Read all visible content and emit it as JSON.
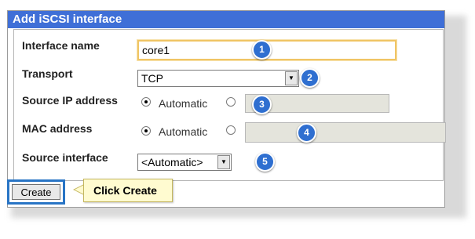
{
  "dialog": {
    "title": "Add iSCSI interface"
  },
  "form": {
    "interface_name": {
      "label": "Interface name",
      "value": "core1"
    },
    "transport": {
      "label": "Transport",
      "value": "TCP"
    },
    "source_ip": {
      "label": "Source IP address",
      "automatic_label": "Automatic",
      "value": ""
    },
    "mac_address": {
      "label": "MAC address",
      "automatic_label": "Automatic",
      "value": ""
    },
    "source_interface": {
      "label": "Source interface",
      "value": "<Automatic>"
    }
  },
  "badges": [
    "1",
    "2",
    "3",
    "4",
    "5"
  ],
  "actions": {
    "create_label": "Create"
  },
  "callout": {
    "text": "Click Create"
  },
  "colors": {
    "title_bar": "#3f6fd7",
    "badge": "#2f6fd0",
    "callout_bg": "#fffbd0",
    "highlight": "#2874c5"
  }
}
